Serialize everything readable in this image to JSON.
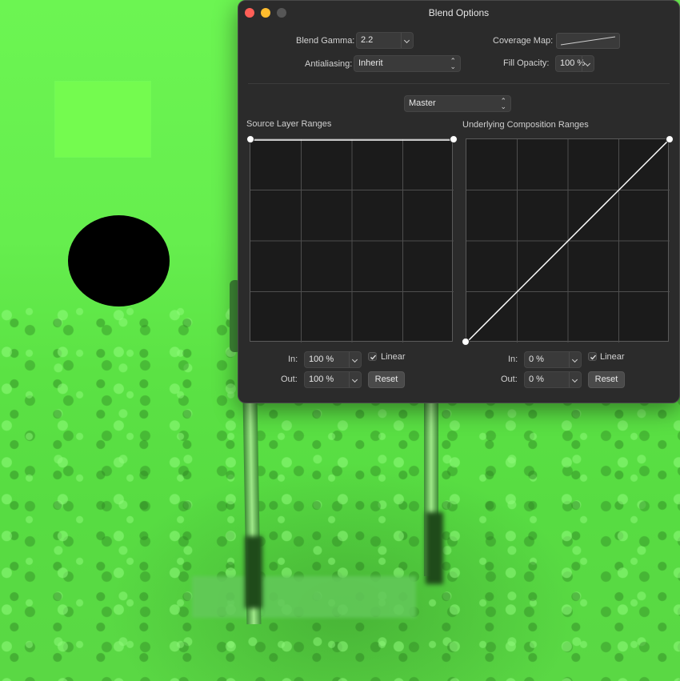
{
  "window": {
    "title": "Blend Options"
  },
  "top_controls": {
    "blend_gamma": {
      "label": "Blend Gamma:",
      "value": "2.2"
    },
    "antialiasing": {
      "label": "Antialiasing:",
      "value": "Inherit"
    },
    "coverage_map": {
      "label": "Coverage Map:"
    },
    "fill_opacity": {
      "label": "Fill Opacity:",
      "value": "100 %"
    }
  },
  "channel": {
    "value": "Master"
  },
  "source": {
    "title": "Source Layer Ranges",
    "in_label": "In:",
    "in_value": "100 %",
    "out_label": "Out:",
    "out_value": "100 %",
    "linear_label": "Linear",
    "linear_checked": true,
    "reset_label": "Reset"
  },
  "underlying": {
    "title": "Underlying Composition Ranges",
    "in_label": "In:",
    "in_value": "0 %",
    "out_label": "Out:",
    "out_value": "0 %",
    "linear_label": "Linear",
    "linear_checked": true,
    "reset_label": "Reset"
  },
  "colors": {
    "panel_bg": "#2b2b2b",
    "graph_bg": "#1b1b1b",
    "close": "#ff5f57",
    "minimize": "#febc2e",
    "canvas_green": "#66ee4e"
  }
}
